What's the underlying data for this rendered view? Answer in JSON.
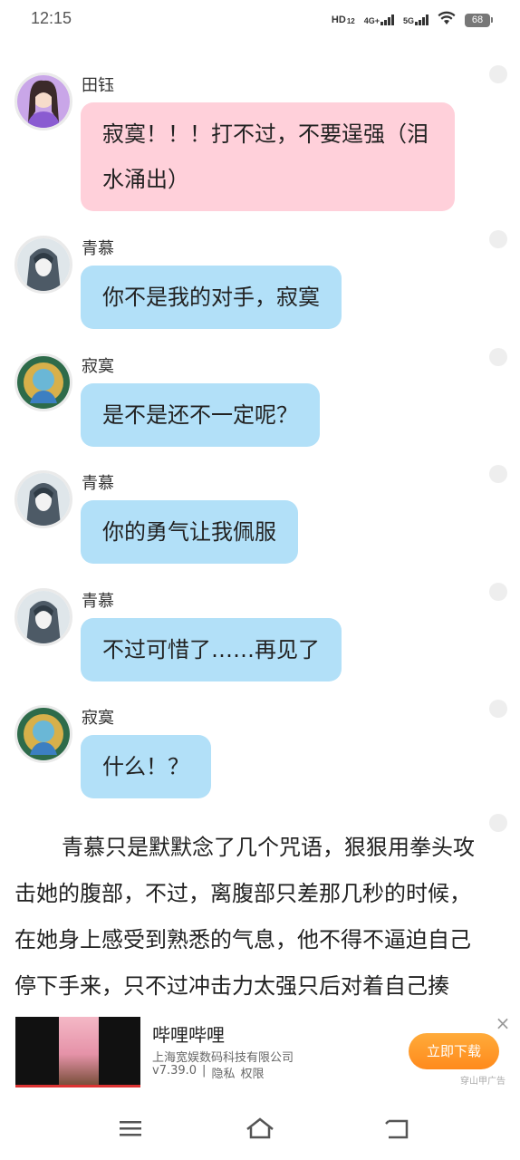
{
  "status_bar": {
    "time": "12:15",
    "hd": "HD",
    "net1": "4G+",
    "net2": "5G",
    "battery": "68"
  },
  "messages": [
    {
      "sender": "田钰",
      "text": "寂寞！！！打不过，不要逞强（泪水涌出）",
      "style": "pink",
      "avatar": "purple-girl-avatar"
    },
    {
      "sender": "青慕",
      "text": "你不是我的对手，寂寞",
      "style": "blue",
      "avatar": "qingmu-avatar"
    },
    {
      "sender": "寂寞",
      "text": "是不是还不一定呢？",
      "style": "blue",
      "avatar": "jimo-avatar"
    },
    {
      "sender": "青慕",
      "text": "你的勇气让我佩服",
      "style": "blue",
      "avatar": "qingmu-avatar"
    },
    {
      "sender": "青慕",
      "text": "不过可惜了……再见了",
      "style": "blue",
      "avatar": "qingmu-avatar"
    },
    {
      "sender": "寂寞",
      "text": "什么！？",
      "style": "blue",
      "avatar": "jimo-avatar"
    }
  ],
  "narration": "青慕只是默默念了几个咒语，狠狠用拳头攻击她的腹部，不过，离腹部只差那几秒的时候，在她身上感受到熟悉的气息，他不得不逼迫自己停下手来，只不过冲击力太强只后对着自己揍",
  "ad": {
    "title": "哔哩哔哩",
    "company": "上海宽娱数码科技有限公司",
    "version": "v7.39.0",
    "separator": "|",
    "privacy": "隐私",
    "permissions": "权限",
    "button": "立即下载",
    "close": "×",
    "source": "穿山甲广告"
  },
  "colors": {
    "pink_bubble": "#ffd0da",
    "blue_bubble": "#b2e0f8",
    "ad_button": "#ff9a2a"
  },
  "nav_icons": [
    "menu-icon",
    "home-icon",
    "back-icon"
  ]
}
